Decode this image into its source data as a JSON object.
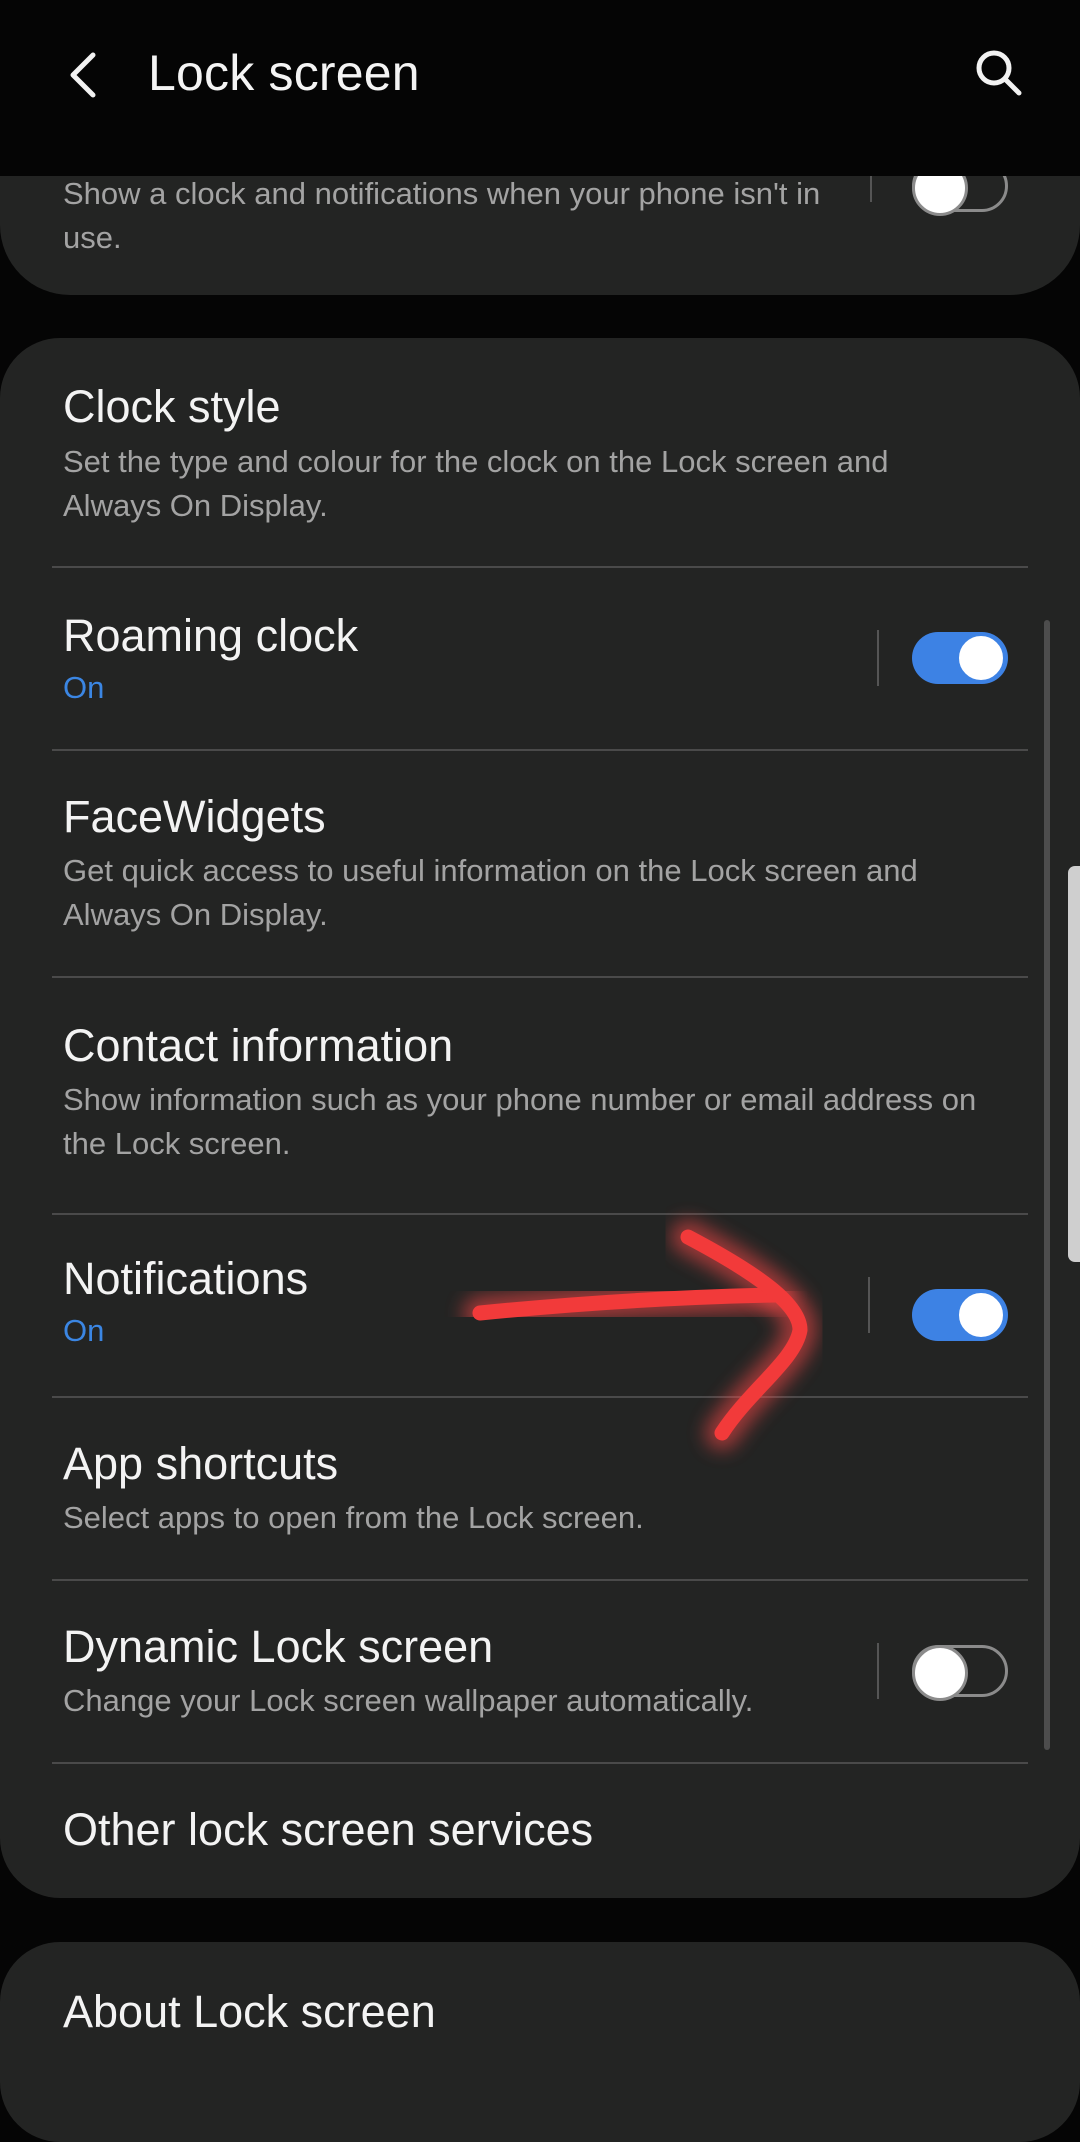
{
  "header": {
    "title": "Lock screen",
    "back_icon": "back-arrow-icon",
    "search_icon": "search-icon"
  },
  "aod": {
    "description": "Show a clock and notifications when your phone isn't in use.",
    "toggle_on": false
  },
  "items": {
    "clock_style": {
      "title": "Clock style",
      "subtitle": "Set the type and colour for the clock on the Lock screen and Always On Display."
    },
    "roaming_clock": {
      "title": "Roaming clock",
      "status": "On",
      "toggle_on": true
    },
    "facewidgets": {
      "title": "FaceWidgets",
      "subtitle": "Get quick access to useful information on the Lock screen and Always On Display."
    },
    "contact_info": {
      "title": "Contact information",
      "subtitle": "Show information such as your phone number or email address on the Lock screen."
    },
    "notifications": {
      "title": "Notifications",
      "status": "On",
      "toggle_on": true
    },
    "app_shortcuts": {
      "title": "App shortcuts",
      "subtitle": "Select apps to open from the Lock screen."
    },
    "dynamic_lock": {
      "title": "Dynamic Lock screen",
      "subtitle": "Change your Lock screen wallpaper automatically.",
      "toggle_on": false
    },
    "other_services": {
      "title": "Other lock screen services"
    }
  },
  "about": {
    "title": "About Lock screen"
  },
  "colors": {
    "accent": "#3d82e4",
    "card": "#232423",
    "background": "#050505",
    "annotation_arrow": "#ff4a4a"
  }
}
